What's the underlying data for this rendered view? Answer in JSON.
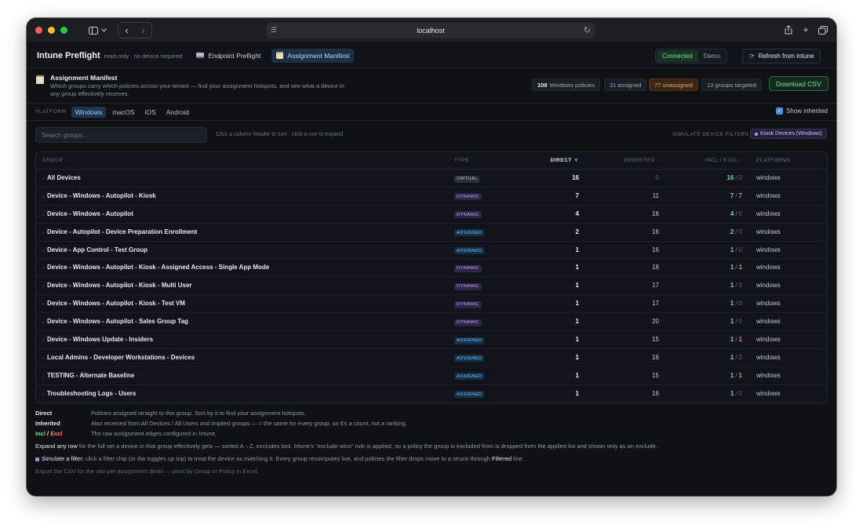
{
  "browser": {
    "url": "localhost"
  },
  "app": {
    "title": "Intune Preflight",
    "subtitle": "read-only · no device required",
    "tabs": [
      {
        "label": "Endpoint Preflight",
        "icon": "laptop-icon",
        "active": false
      },
      {
        "label": "Assignment Manifest",
        "icon": "clipboard-icon",
        "active": true
      }
    ],
    "mode": {
      "connected": "Connected",
      "demo": "Demo",
      "active": "Connected"
    },
    "refresh_label": "Refresh from Intune"
  },
  "manifest": {
    "title": "Assignment Manifest",
    "description": "Which groups carry which policies across your tenant — find your assignment hotspots, and see what a device in any group effectively receives.",
    "stats": {
      "policies_count": "108",
      "policies_label": "Windows policies",
      "assigned": "31 assigned",
      "unassigned": "77 unassigned",
      "groups": "13 groups targeted"
    },
    "download_label": "Download CSV"
  },
  "platforms": {
    "label": "PLATFORM",
    "options": [
      "Windows",
      "macOS",
      "iOS",
      "Android"
    ],
    "selected": "Windows",
    "show_inherited_label": "Show inherited",
    "show_inherited": true
  },
  "search": {
    "placeholder": "Search groups...",
    "value": "",
    "hint": "Click a column header to sort · click a row to expand",
    "simulate_label": "SIMULATE DEVICE FILTERS",
    "filter_chip": "Kiosk Devices (Windows)"
  },
  "table": {
    "headers": {
      "group": "GROUP ◦",
      "type": "TYPE",
      "direct": "DIRECT",
      "direct_sort": "▼",
      "inherited": "INHERITED ◦",
      "incl_excl": "INCL / EXCL ◦",
      "platforms": "PLATFORMS"
    },
    "rows": [
      {
        "group": "All Devices",
        "type": "VIRTUAL",
        "direct": "16",
        "inherited": "0",
        "incl": "16",
        "excl": "0",
        "platforms": "windows"
      },
      {
        "group": "Device - Windows - Autopilot - Kiosk",
        "type": "DYNAMIC",
        "direct": "7",
        "inherited": "11",
        "incl": "7",
        "excl": "7",
        "platforms": "windows"
      },
      {
        "group": "Device - Windows - Autopilot",
        "type": "DYNAMIC",
        "direct": "4",
        "inherited": "16",
        "incl": "4",
        "excl": "0",
        "platforms": "windows"
      },
      {
        "group": "Device - Autopilot - Device Preparation Enrollment",
        "type": "ASSIGNED",
        "direct": "2",
        "inherited": "16",
        "incl": "2",
        "excl": "0",
        "platforms": "windows"
      },
      {
        "group": "Device - App Control - Test Group",
        "type": "ASSIGNED",
        "direct": "1",
        "inherited": "16",
        "incl": "1",
        "excl": "0",
        "platforms": "windows"
      },
      {
        "group": "Device - Windows - Autopilot - Kiosk - Assigned Access - Single App Mode",
        "type": "DYNAMIC",
        "direct": "1",
        "inherited": "16",
        "incl": "1",
        "excl": "1",
        "platforms": "windows"
      },
      {
        "group": "Device - Windows - Autopilot - Kiosk - Multi User",
        "type": "DYNAMIC",
        "direct": "1",
        "inherited": "17",
        "incl": "1",
        "excl": "0",
        "platforms": "windows"
      },
      {
        "group": "Device - Windows - Autopilot - Kiosk - Test VM",
        "type": "DYNAMIC",
        "direct": "1",
        "inherited": "17",
        "incl": "1",
        "excl": "0",
        "platforms": "windows"
      },
      {
        "group": "Device - Windows - Autopilot - Sales Group Tag",
        "type": "DYNAMIC",
        "direct": "1",
        "inherited": "20",
        "incl": "1",
        "excl": "0",
        "platforms": "windows"
      },
      {
        "group": "Device - Windows Update - Insiders",
        "type": "ASSIGNED",
        "direct": "1",
        "inherited": "15",
        "incl": "1",
        "excl": "1",
        "platforms": "windows"
      },
      {
        "group": "Local Admins - Developer Workstations - Devices",
        "type": "ASSIGNED",
        "direct": "1",
        "inherited": "16",
        "incl": "1",
        "excl": "0",
        "platforms": "windows"
      },
      {
        "group": "TESTING - Alternate Baseline",
        "type": "ASSIGNED",
        "direct": "1",
        "inherited": "15",
        "incl": "1",
        "excl": "1",
        "platforms": "windows"
      },
      {
        "group": "Troubleshooting Logs - Users",
        "type": "ASSIGNED",
        "direct": "1",
        "inherited": "16",
        "incl": "1",
        "excl": "0",
        "platforms": "windows"
      }
    ]
  },
  "legend": {
    "direct_term": "Direct",
    "direct_text": "Policies assigned straight to this group. Sort by it to find your assignment hotspots.",
    "inherited_term": "Inherited",
    "inherited_text": "Also received from All Devices / All Users and implied groups — ≈ the same for every group, so it's a count, not a ranking.",
    "incl_term": "Incl",
    "excl_term": "Excl",
    "incl_excl_text": "The raw assignment edges configured in Intune.",
    "expand_a": "Expand any row",
    "expand_b": " for the full set a device in that group effectively gets — sorted A→Z, excludes last. Intune's \"exclude wins\" rule is applied, so a policy the group is excluded from is dropped from the applied list and shown only as an exclude.",
    "simulate_a": "Simulate a filter:",
    "simulate_b": " click a filter chip (or the toggles up top) to treat the device as matching it. Every group recomputes live, and policies the filter drops move to a struck-through ",
    "simulate_c": "Filtered",
    "simulate_d": " line.",
    "export": "Export the CSV for the raw per-assignment detail — pivot by Group or Policy in Excel."
  }
}
